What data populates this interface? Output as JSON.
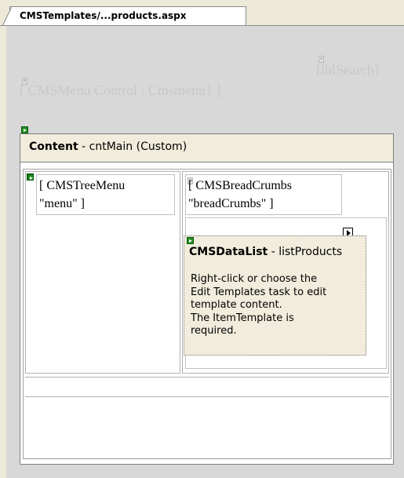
{
  "tab": {
    "title": "CMSTemplates/...products.aspx"
  },
  "controls": {
    "lblsearch": "[lblSearch]",
    "cmsmenu": "[ CMSMenu Control : Cmsmenu1 ]"
  },
  "content": {
    "bold": "Content",
    "rest": " - cntMain (Custom)"
  },
  "treemenu": {
    "line1": "[ CMSTreeMenu",
    "line2": "\"menu\" ]"
  },
  "breadcrumbs": {
    "line1": "[ CMSBreadCrumbs",
    "line2": "\"breadCrumbs\" ]"
  },
  "datalist": {
    "name": "CMSDataList",
    "id": " - listProducts",
    "message": [
      "Right-click or choose the",
      "Edit Templates task to edit",
      "template content.",
      "The ItemTemplate is",
      "required."
    ]
  }
}
